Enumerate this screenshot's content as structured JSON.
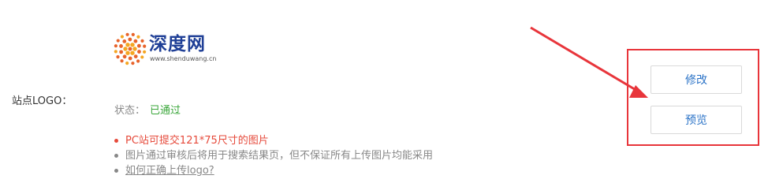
{
  "field": {
    "label": "站点LOGO："
  },
  "logo": {
    "brand_text": "深度网",
    "brand_url": "www.shenduwang.cn",
    "accent_colors": [
      "#e8632a",
      "#f5a623",
      "#1f3f96"
    ]
  },
  "status": {
    "label": "状态：",
    "value": "已通过",
    "value_color": "#3aa63a"
  },
  "tips": {
    "warning": "PC站可提交121*75尺寸的图片",
    "info": "图片通过审核后将用于搜索结果页，但不保证所有上传图片均能采用",
    "help_link": "如何正确上传logo?"
  },
  "actions": {
    "edit_label": "修改",
    "preview_label": "预览"
  },
  "annotation": {
    "color": "#e8353b",
    "icon": "red-arrow-icon"
  }
}
